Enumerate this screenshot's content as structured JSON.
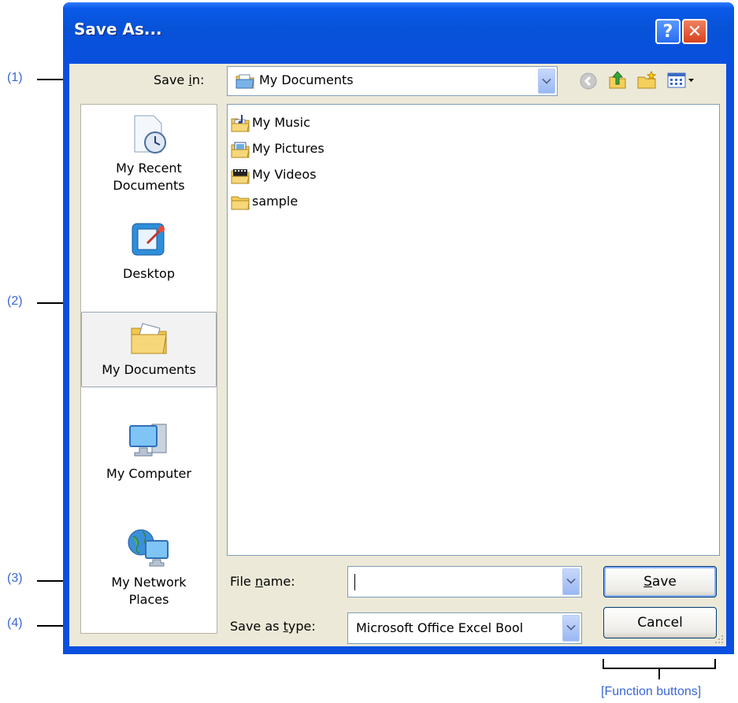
{
  "dialog": {
    "title": "Save As...",
    "help_label": "?",
    "close_label": "✕"
  },
  "toolbar": {
    "save_in_label_pre": "Save ",
    "save_in_label_key": "i",
    "save_in_label_post": "n:",
    "save_in_value": "My Documents"
  },
  "places": [
    {
      "label_line1": "My Recent",
      "label_line2": "Documents",
      "icon": "recent-documents-icon"
    },
    {
      "label_line1": "Desktop",
      "label_line2": "",
      "icon": "desktop-icon"
    },
    {
      "label_line1": "My Documents",
      "label_line2": "",
      "icon": "my-documents-icon",
      "selected": true
    },
    {
      "label_line1": "My Computer",
      "label_line2": "",
      "icon": "my-computer-icon"
    },
    {
      "label_line1": "My Network",
      "label_line2": "Places",
      "icon": "network-places-icon"
    }
  ],
  "files": [
    {
      "name": "My Music",
      "icon": "music-folder-icon"
    },
    {
      "name": "My Pictures",
      "icon": "pictures-folder-icon"
    },
    {
      "name": "My Videos",
      "icon": "videos-folder-icon"
    },
    {
      "name": "sample",
      "icon": "folder-icon"
    }
  ],
  "form": {
    "file_name_pre": "File ",
    "file_name_key": "n",
    "file_name_post": "ame:",
    "file_name_value": "",
    "save_type_pre": "Save as ",
    "save_type_key": "t",
    "save_type_post": "ype:",
    "save_type_value": "Microsoft Office Excel Bool"
  },
  "buttons": {
    "save_key": "S",
    "save_rest": "ave",
    "cancel": "Cancel"
  },
  "callouts": {
    "c1": "(1)",
    "c2": "(2)",
    "c3": "(3)",
    "c4": "(4)",
    "function_buttons": "[Function buttons]"
  },
  "colors": {
    "callout": "#3a66d6",
    "titlebar": "#0a4fe0",
    "dialog_bg": "#ece9d8"
  }
}
